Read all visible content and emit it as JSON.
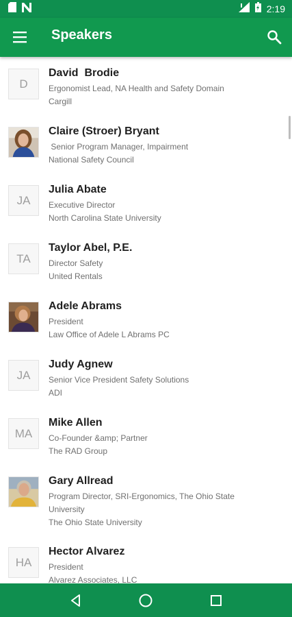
{
  "status_bar": {
    "time": "2:19",
    "left_icons": [
      "sd-card-icon",
      "n-notification-icon"
    ],
    "right_icons": [
      "signal-icon",
      "battery-icon"
    ]
  },
  "app_bar": {
    "title": "Speakers",
    "menu_icon": "hamburger-menu-icon",
    "search_icon": "search-icon",
    "color": "#11994f"
  },
  "speakers": [
    {
      "name": "David  Brodie",
      "initials": "D",
      "photo": false,
      "role": "Ergonomist Lead, NA Health and Safety Domain\nCargill"
    },
    {
      "name": "Claire (Stroer) Bryant",
      "initials": "",
      "photo": true,
      "role": " Senior Program Manager, Impairment\nNational Safety Council"
    },
    {
      "name": "Julia Abate",
      "initials": "JA",
      "photo": false,
      "role": "Executive Director\nNorth Carolina State University"
    },
    {
      "name": "Taylor Abel, P.E.",
      "initials": "TA",
      "photo": false,
      "role": "Director Safety\nUnited Rentals"
    },
    {
      "name": "Adele Abrams",
      "initials": "",
      "photo": true,
      "role": "President\nLaw Office of Adele L Abrams PC"
    },
    {
      "name": "Judy Agnew",
      "initials": "JA",
      "photo": false,
      "role": "Senior Vice President Safety Solutions\nADI"
    },
    {
      "name": "Mike Allen",
      "initials": "MA",
      "photo": false,
      "role": "Co-Founder &amp; Partner\nThe RAD Group"
    },
    {
      "name": "Gary Allread",
      "initials": "",
      "photo": true,
      "role": "Program Director, SRI-Ergonomics, The Ohio State\nUniversity\nThe Ohio State University"
    },
    {
      "name": "Hector Alvarez",
      "initials": "HA",
      "photo": false,
      "role": "President\nAlvarez Associates, LLC"
    }
  ],
  "nav_bar": {
    "icons": [
      "back-icon",
      "home-icon",
      "recents-icon"
    ]
  }
}
